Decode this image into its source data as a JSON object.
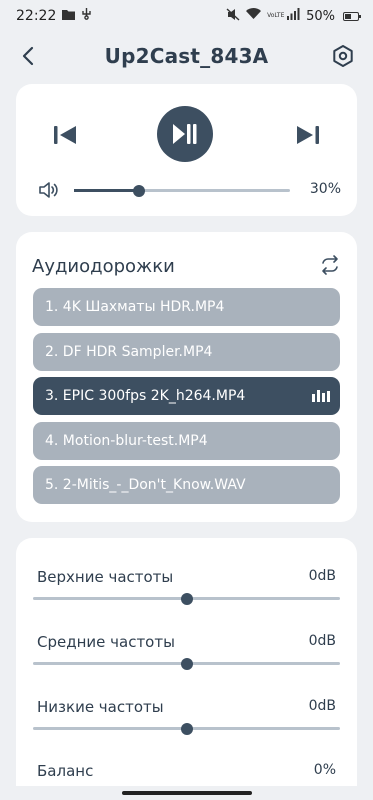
{
  "status_bar": {
    "time": "22:22",
    "battery_text": "50%",
    "battery_level": 0.5,
    "left_icons": [
      "folder-icon",
      "usb-debug-icon"
    ],
    "right_icons": [
      "mute-icon",
      "wifi-icon",
      "volte-icon",
      "signal-icon",
      "battery-icon"
    ],
    "volte_text": "VoLTE"
  },
  "header": {
    "title": "Up2Cast_843A",
    "back_icon": "chevron-left-icon",
    "settings_icon": "settings-hexagon-icon"
  },
  "player": {
    "prev_icon": "skip-previous-icon",
    "play_icon": "play-pause-icon",
    "next_icon": "skip-next-icon",
    "volume_icon": "speaker-icon",
    "volume_percent": 30,
    "volume_label": "30%",
    "accent_color": "#3d4f61"
  },
  "playlist": {
    "title": "Аудиодорожки",
    "repeat_icon": "repeat-icon",
    "tracks": [
      {
        "label": "1. 4K Шахматы HDR.MP4",
        "active": false
      },
      {
        "label": "2. DF HDR Sampler.MP4",
        "active": false
      },
      {
        "label": "3. EPIC 300fps 2K_h264.MP4",
        "active": true
      },
      {
        "label": "4. Motion-blur-test.MP4",
        "active": false
      },
      {
        "label": "5. 2-Mitis_-_Don't_Know.WAV",
        "active": false
      }
    ],
    "track_color": "#a9b2bc",
    "active_color": "#3d4f61"
  },
  "equalizer": {
    "bands": [
      {
        "label": "Верхние частоты",
        "value": "0dB",
        "position": 0.5
      },
      {
        "label": "Средние частоты",
        "value": "0dB",
        "position": 0.5
      },
      {
        "label": "Низкие частоты",
        "value": "0dB",
        "position": 0.5
      },
      {
        "label": "Баланс",
        "value": "0%",
        "position": 0.5
      }
    ]
  }
}
